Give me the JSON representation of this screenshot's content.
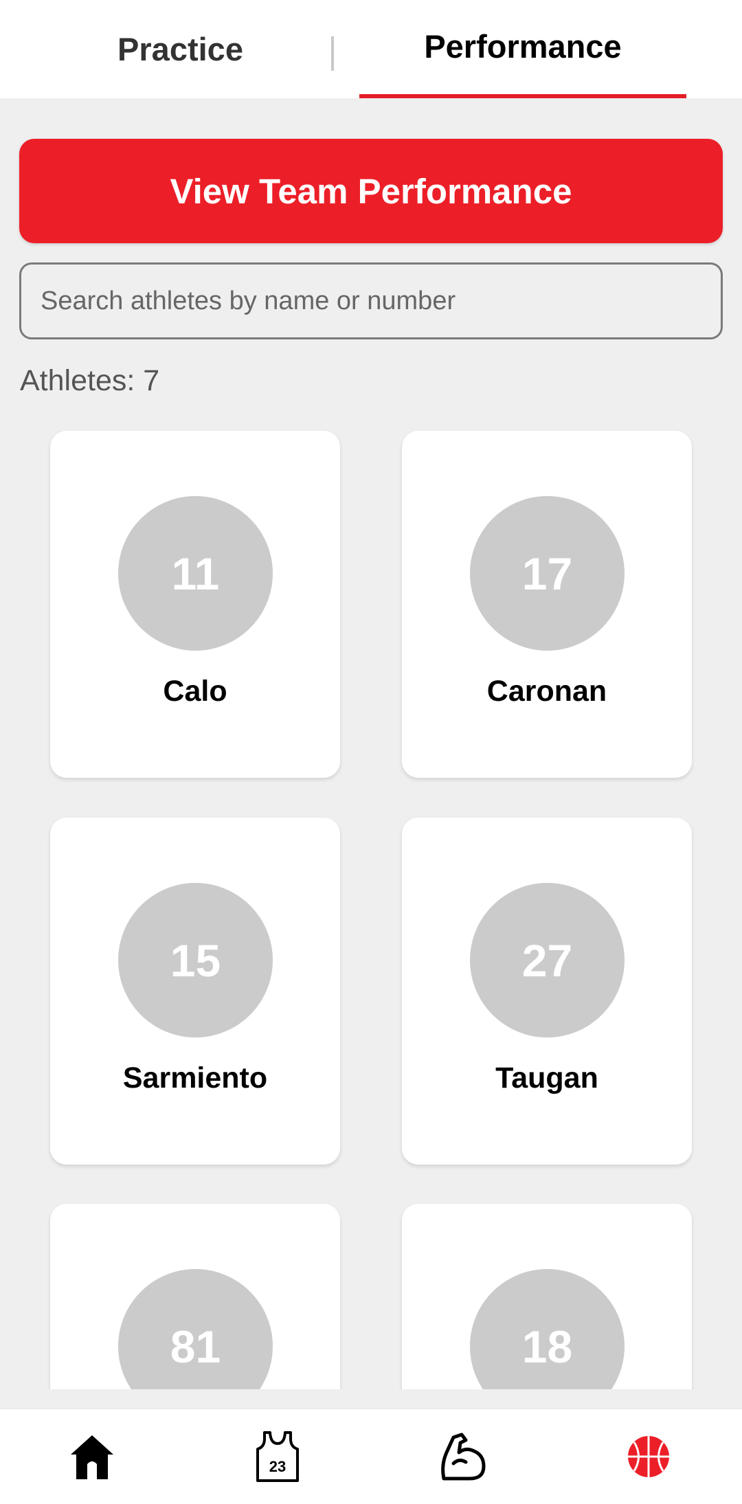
{
  "tabs": {
    "practice": "Practice",
    "performance": "Performance"
  },
  "team_button": "View Team Performance",
  "search": {
    "placeholder": "Search athletes by name or number",
    "value": ""
  },
  "athletes_count_label": "Athletes: 7",
  "athletes": [
    {
      "number": "11",
      "name": "Calo"
    },
    {
      "number": "17",
      "name": "Caronan"
    },
    {
      "number": "15",
      "name": "Sarmiento"
    },
    {
      "number": "27",
      "name": "Taugan"
    },
    {
      "number": "81",
      "name": ""
    },
    {
      "number": "18",
      "name": ""
    }
  ],
  "bottom_nav": [
    {
      "icon": "home-icon"
    },
    {
      "icon": "jersey-icon",
      "label": "23"
    },
    {
      "icon": "muscle-icon"
    },
    {
      "icon": "basketball-icon"
    }
  ],
  "colors": {
    "accent": "#ec1f28",
    "avatar": "#cbcbcb",
    "background": "#efefef"
  }
}
